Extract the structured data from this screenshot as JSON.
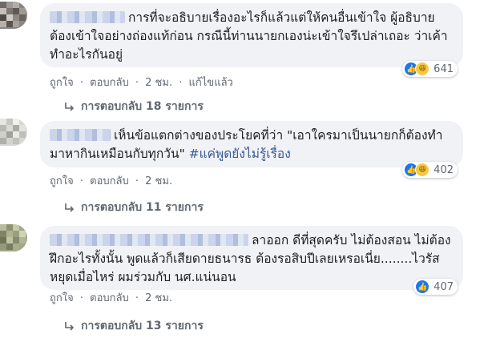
{
  "comments": [
    {
      "text": "การที่จะอธิบายเรื่องอะไรก็แล้วแต่ให้คนอื่นเข้าใจ ผู้อธิบายต้องเข้าใจอย่างถ่องแท้ก่อน กรณีนี้ท่านนายกเองน่ะเข้าใจรึเปล่าเถอะ ว่าเค้าทำอะไรกันอยู่",
      "hashtag": "",
      "reaction_count": "641",
      "reactions": [
        "like-icon",
        "haha-icon"
      ],
      "like_label": "ถูกใจ",
      "reply_label": "ตอบกลับ",
      "time": "2 ชม.",
      "edited_label": "แก้ไขแล้ว",
      "replies_label": "การตอบกลับ 18 รายการ"
    },
    {
      "text": "เห็นข้อแตกต่างของประโยคที่ว่า \"เอาใครมาเป็นนายกก็ต้องทำมาหากินเหมือนกับทุกวัน\"",
      "hashtag": "#แค่พูดยังไม่รู้เรื่อง",
      "reaction_count": "402",
      "reactions": [
        "like-icon",
        "haha-icon"
      ],
      "like_label": "ถูกใจ",
      "reply_label": "ตอบกลับ",
      "time": "2 ชม.",
      "edited_label": "",
      "replies_label": "การตอบกลับ 11 รายการ"
    },
    {
      "text": "ลาออก ดีที่สุดครับ ไม่ต้องสอน ไม่ต้องฝึกอะไรทั้งนั้น พูดแล้วก็เสียดายธนารธ ต้องรอสิบปีเลยเหรอเนี่ย........ไวรัสหยุดเมื่อไหร่ ผมร่วมกับ นศ.แน่นอน",
      "hashtag": "",
      "reaction_count": "407",
      "reactions": [
        "like-icon"
      ],
      "like_label": "ถูกใจ",
      "reply_label": "ตอบกลับ",
      "time": "2 ชม.",
      "edited_label": "",
      "replies_label": "การตอบกลับ 13 รายการ"
    }
  ],
  "colors": {
    "bubble": "#f0f2f5",
    "text": "#1c1e21",
    "meta": "#606770",
    "hashtag": "#385898",
    "like": "#1877f2"
  }
}
